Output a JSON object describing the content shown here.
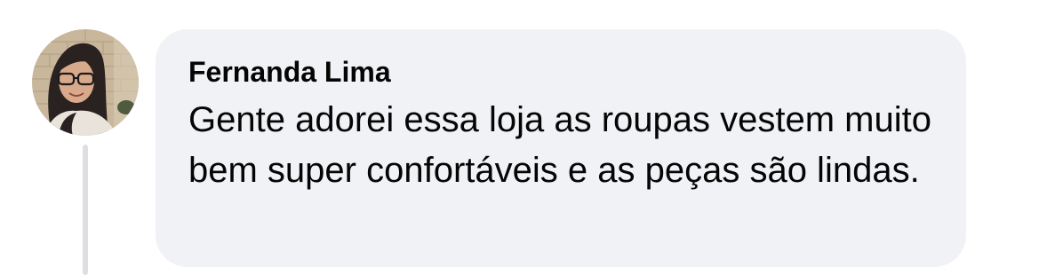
{
  "comment": {
    "author": "Fernanda Lima",
    "text": "Gente adorei essa loja as roupas vestem muito bem super confortáveis e as peças são lindas.",
    "avatar_icon": "user-photo-avatar"
  },
  "colors": {
    "bubble_background": "#f0f2f5",
    "text": "#050505",
    "thread_line": "#dcdee2"
  }
}
